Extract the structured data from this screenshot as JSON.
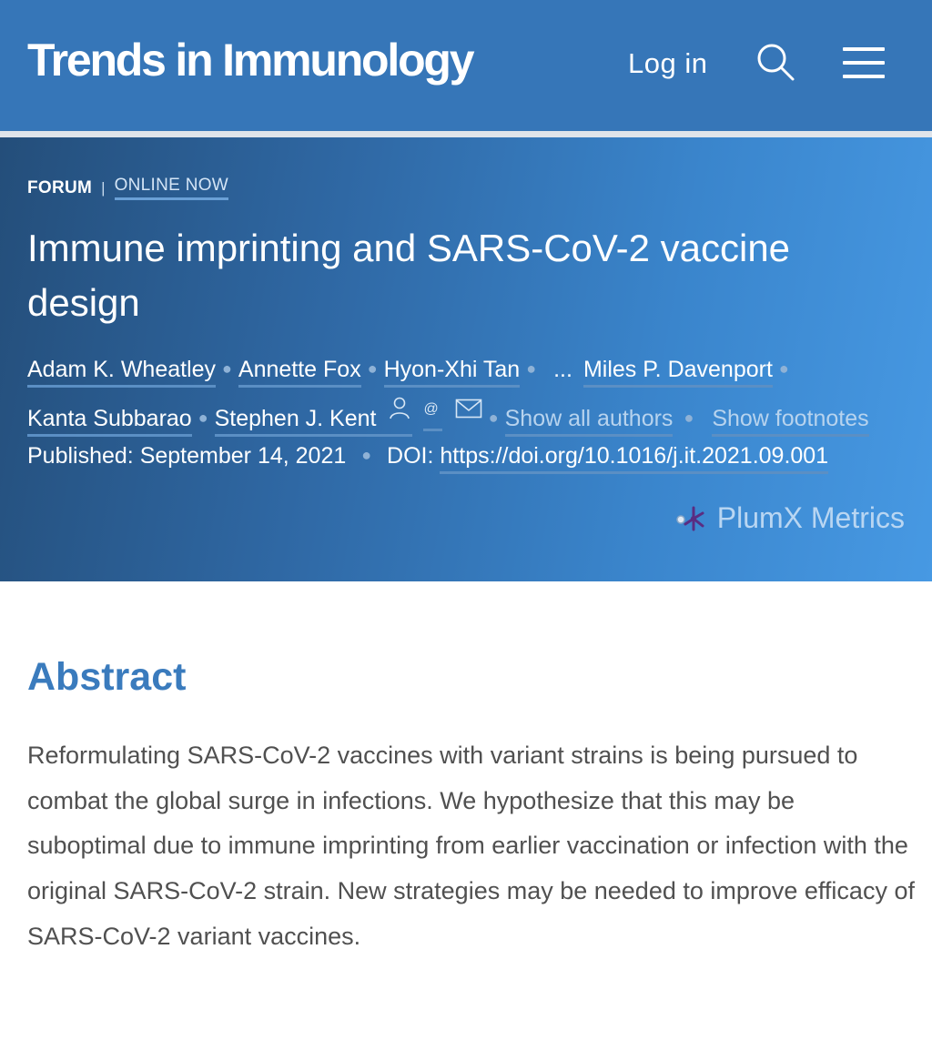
{
  "header": {
    "brand": "Trends in Immunology",
    "login_label": "Log in",
    "search_icon": "search-icon",
    "menu_icon": "hamburger-menu-icon"
  },
  "article": {
    "type": "FORUM",
    "status": "ONLINE NOW",
    "title": "Immune imprinting and SARS-CoV-2 vaccine design",
    "authors_line1": [
      "Adam K. Wheatley",
      "Annette Fox",
      "Hyon-Xhi Tan"
    ],
    "ellipsis": "...",
    "authors_line1_end": "Miles P. Davenport",
    "authors_line2": [
      "Kanta Subbarao",
      "Stephen J. Kent"
    ],
    "show_all_authors": "Show all authors",
    "show_footnotes": "Show footnotes",
    "published_label": "Published:",
    "published_date": "September 14, 2021",
    "doi_label": "DOI:",
    "doi": "https://doi.org/10.1016/j.it.2021.09.001",
    "plumx_label": "PlumX Metrics"
  },
  "abstract": {
    "heading": "Abstract",
    "body": "Reformulating SARS-CoV-2 vaccines with variant strains is being pursued to combat the global surge in infections. We hypothesize that this may be suboptimal due to immune imprinting from earlier vaccination or infection with the original SARS-CoV-2 strain. New strategies may be needed to improve efficacy of SARS-CoV-2 variant vaccines."
  },
  "colors": {
    "header_bg": "#3676b8",
    "hero_gradient_start": "#244e7a",
    "hero_gradient_end": "#4799e3",
    "abstract_heading": "#3a7bbd",
    "body_text": "#505050"
  }
}
